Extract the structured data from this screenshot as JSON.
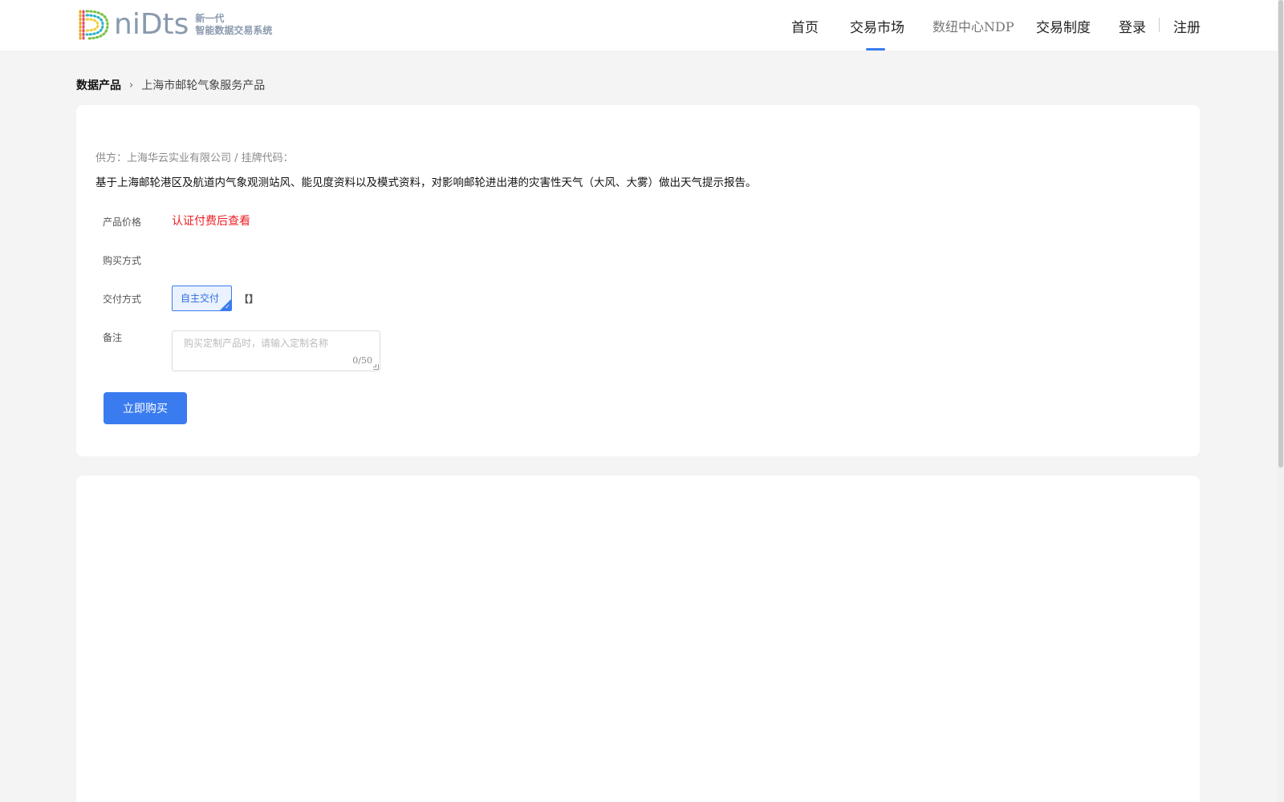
{
  "brand": {
    "wordmark": "niDts",
    "tagline_line1": "新一代",
    "tagline_line2": "智能数据交易系统"
  },
  "nav": {
    "items": [
      {
        "label": "首页"
      },
      {
        "label": "交易市场",
        "active": true
      },
      {
        "label": "数纽中心NDP"
      },
      {
        "label": "交易制度"
      }
    ],
    "login": "登录",
    "register": "注册",
    "accent_color": "#3a7bf0"
  },
  "breadcrumb": {
    "root": "数据产品",
    "current": "上海市邮轮气象服务产品"
  },
  "product": {
    "supplier_line": "供方：上海华云实业有限公司 / 挂牌代码：",
    "description": "基于上海邮轮港区及航道内气象观测站风、能见度资料以及模式资料，对影响邮轮进出港的灾害性天气（大风、大雾）做出天气提示报告。",
    "price_label": "产品价格",
    "price_value": "认证付费后查看",
    "price_color": "#ee1d23",
    "purchase_label": "购买方式",
    "delivery_label": "交付方式",
    "delivery_option": "自主交付",
    "remark_label": "备注",
    "remark_placeholder": "购买定制产品时，请输入定制名称",
    "remark_count": "0/50",
    "buy_button": "立即购买"
  },
  "icons": {
    "bracket": "【】",
    "chevron": "›",
    "check": "✓"
  }
}
